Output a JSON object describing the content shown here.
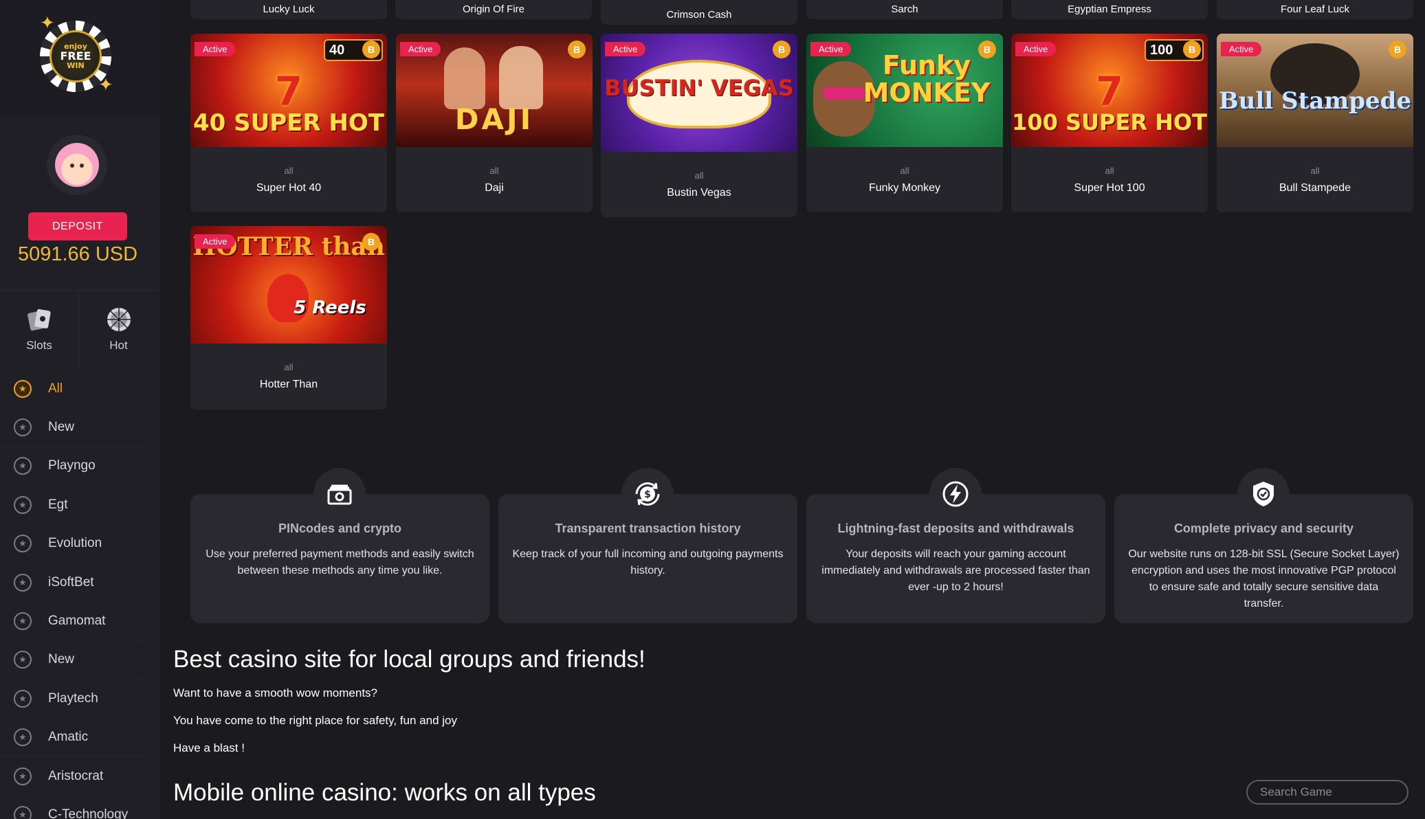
{
  "sidebar": {
    "logo": {
      "line1": "enjoy",
      "line2": "FREE",
      "line3": "WIN"
    },
    "deposit_label": "DEPOSIT",
    "balance": "5091.66 USD",
    "tabs": [
      {
        "label": "Slots",
        "icon": "cards-icon"
      },
      {
        "label": "Hot",
        "icon": "roulette-icon"
      }
    ],
    "menu": [
      {
        "label": "All",
        "active": true
      },
      {
        "label": "New"
      },
      {
        "label": "Playngo"
      },
      {
        "label": "Egt"
      },
      {
        "label": "Evolution"
      },
      {
        "label": "iSoftBet"
      },
      {
        "label": "Gamomat"
      },
      {
        "label": "New"
      },
      {
        "label": "Playtech"
      },
      {
        "label": "Amatic"
      },
      {
        "label": "Aristocrat"
      },
      {
        "label": "C-Technology"
      }
    ]
  },
  "top_row": [
    "Lucky Luck",
    "Origin Of Fire",
    "Crimson Cash",
    "Sarch",
    "Egyptian Empress",
    "Four Leaf Luck"
  ],
  "games": [
    {
      "name": "Super Hot 40",
      "category": "all",
      "badge": "Active",
      "coin": "B",
      "bet": "40",
      "thumb_text": "40 SUPER HOT"
    },
    {
      "name": "Daji",
      "category": "all",
      "badge": "Active",
      "coin": "B",
      "thumb_text": "DAJI"
    },
    {
      "name": "Bustin Vegas",
      "category": "all",
      "badge": "Active",
      "coin": "B",
      "thumb_text": "BUSTIN' VEGAS"
    },
    {
      "name": "Funky Monkey",
      "category": "all",
      "badge": "Active",
      "coin": "B",
      "thumb_text": "Funky MONKEY"
    },
    {
      "name": "Super Hot 100",
      "category": "all",
      "badge": "Active",
      "coin": "B",
      "bet": "100",
      "thumb_text": "100 SUPER HOT"
    },
    {
      "name": "Bull Stampede",
      "category": "all",
      "badge": "Active",
      "coin": "B",
      "thumb_text": "Bull Stampede"
    },
    {
      "name": "Hotter Than",
      "category": "all",
      "badge": "Active",
      "coin": "B",
      "thumb_text": "HOTTER than",
      "thumb_sub": "5 Reels"
    }
  ],
  "features": [
    {
      "title": "PINcodes and crypto",
      "desc": "Use your preferred payment methods and easily switch between these methods any time you like.",
      "icon": "cash-icon"
    },
    {
      "title": "Transparent transaction history",
      "desc": "Keep track of your full incoming and outgoing payments history.",
      "icon": "exchange-icon"
    },
    {
      "title": "Lightning-fast deposits and withdrawals",
      "desc": "Your deposits will reach your gaming account immediately and withdrawals are processed faster than ever -up to 2 hours!",
      "icon": "lightning-icon"
    },
    {
      "title": "Complete privacy and security",
      "desc": "Our website runs on 128-bit SSL (Secure Socket Layer) encryption and uses the most innovative PGP protocol to ensure safe and totally secure sensitive data transfer.",
      "icon": "shield-icon"
    }
  ],
  "content": {
    "heading1": "Best casino site for local groups and friends!",
    "paragraphs": [
      "Want to have a smooth wow moments?",
      "You have come to the right place for safety, fun and joy",
      "Have a blast !"
    ],
    "heading2": "Mobile online casino: works on all types"
  },
  "search": {
    "placeholder": "Search Game"
  },
  "colors": {
    "accent": "#e8234f",
    "gold": "#f0a320",
    "bg": "#1b1a1f",
    "card": "#26252b"
  }
}
